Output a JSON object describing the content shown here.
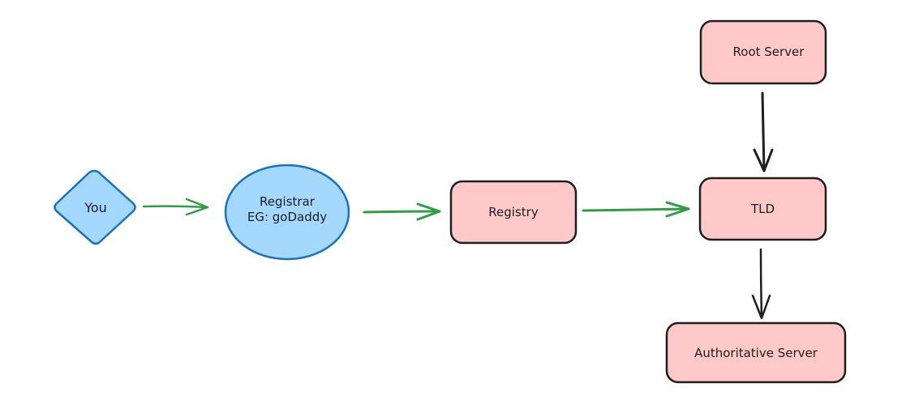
{
  "diagram": {
    "colors": {
      "blue_fill": "#a5d8ff",
      "blue_stroke": "#1971c2",
      "pink_fill": "#ffc9c9",
      "dark_stroke": "#1e1e1e",
      "green_arrow": "#2f9e44",
      "black_arrow": "#1e1e1e"
    },
    "nodes": {
      "you": {
        "label": "You",
        "shape": "diamond"
      },
      "registrar": {
        "label": "Registrar\nEG: goDaddy",
        "shape": "ellipse"
      },
      "registry": {
        "label": "Registry",
        "shape": "rounded-rectangle"
      },
      "tld": {
        "label": "TLD",
        "shape": "rounded-rectangle"
      },
      "root_server": {
        "label": "Root Server",
        "shape": "rounded-rectangle"
      },
      "authoritative_server": {
        "label": "Authoritative Server",
        "shape": "rounded-rectangle"
      }
    },
    "edges": [
      {
        "from": "you",
        "to": "registrar",
        "color": "green"
      },
      {
        "from": "registrar",
        "to": "registry",
        "color": "green"
      },
      {
        "from": "registry",
        "to": "tld",
        "color": "green"
      },
      {
        "from": "root_server",
        "to": "tld",
        "color": "black"
      },
      {
        "from": "tld",
        "to": "authoritative_server",
        "color": "black"
      }
    ]
  }
}
